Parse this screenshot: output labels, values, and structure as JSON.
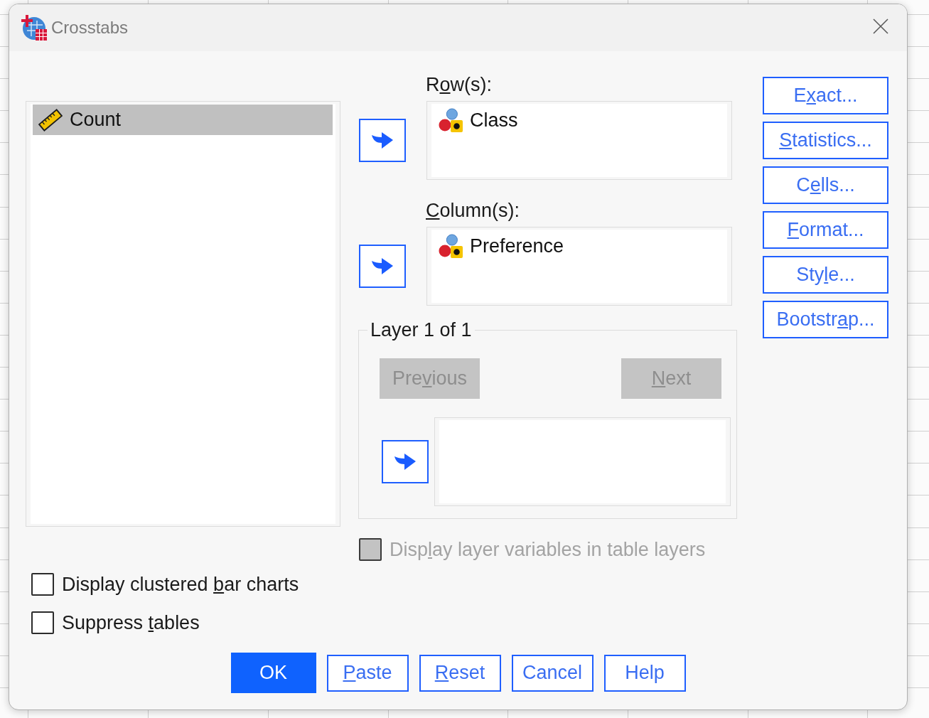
{
  "window": {
    "title": "Crosstabs"
  },
  "source_list": {
    "items": [
      {
        "label": "Count",
        "kind": "scale",
        "selected": true
      }
    ]
  },
  "target_lists": [
    {
      "label": {
        "before": "R",
        "underlined": "o",
        "after": "w(s):"
      },
      "items": [
        {
          "label": "Class",
          "kind": "nominal",
          "selected": false
        }
      ]
    },
    {
      "label": {
        "underlined": "C",
        "after": "olumn(s):"
      },
      "items": [
        {
          "label": "Preference",
          "kind": "nominal",
          "selected": false
        }
      ]
    }
  ],
  "layer": {
    "title": "Layer 1 of 1",
    "buttons": [
      {
        "label": {
          "before": "Pre",
          "underlined": "v",
          "after": "ious"
        },
        "disabled": true
      },
      {
        "label": {
          "underlined": "N",
          "after": "ext"
        },
        "disabled": true
      }
    ]
  },
  "layer_option": {
    "label": {
      "before": "Disp",
      "underlined": "l",
      "after": "ay layer variables in table layers"
    },
    "checked": false,
    "disabled": true
  },
  "options": [
    {
      "label": {
        "before": "Display clustered ",
        "underlined": "b",
        "after": "ar charts"
      },
      "checked": false,
      "disabled": false
    },
    {
      "label": {
        "before": "Suppress ",
        "underlined": "t",
        "after": "ables"
      },
      "checked": false,
      "disabled": false
    }
  ],
  "side_buttons": [
    {
      "label": {
        "before": "E",
        "underlined": "x",
        "after": "act..."
      }
    },
    {
      "label": {
        "underlined": "S",
        "after": "tatistics..."
      }
    },
    {
      "label": {
        "before": "C",
        "underlined": "e",
        "after": "lls..."
      }
    },
    {
      "label": {
        "underlined": "F",
        "after": "ormat..."
      }
    },
    {
      "label": {
        "before": "Sty",
        "underlined": "l",
        "after": "e..."
      }
    },
    {
      "label": {
        "before": "Bootstr",
        "underlined": "a",
        "after": "p..."
      }
    }
  ],
  "buttons": [
    {
      "label": "OK",
      "primary": true
    },
    {
      "label": {
        "underlined": "P",
        "after": "aste"
      },
      "primary": false
    },
    {
      "label": {
        "underlined": "R",
        "after": "eset"
      },
      "primary": false
    },
    {
      "label": "Cancel",
      "primary": false
    },
    {
      "label": "Help",
      "primary": false
    }
  ]
}
